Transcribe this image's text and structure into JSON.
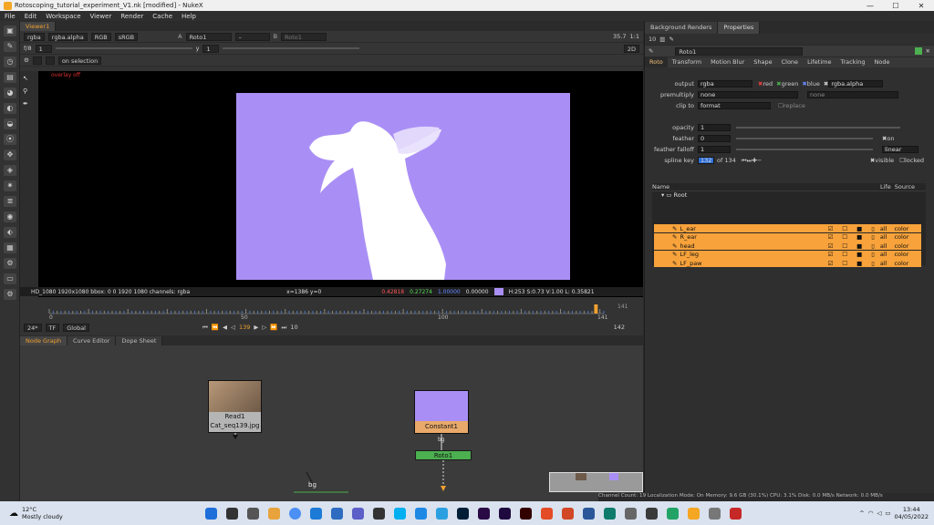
{
  "window": {
    "title": "Rotoscoping_tutorial_experiment_V1.nk [modified] - NukeX",
    "controls": [
      "—",
      "☐",
      "✕"
    ]
  },
  "menu": [
    "File",
    "Edit",
    "Workspace",
    "Viewer",
    "Render",
    "Cache",
    "Help"
  ],
  "viewer": {
    "tab": "Viewer1",
    "channels": "rgba",
    "alpha": "rgba.alpha",
    "colorspace_label": "RGB",
    "lut": "sRGB",
    "input_a_label": "A",
    "input_a": "Roto1",
    "input_b_label": "B",
    "input_b": "Roto1",
    "fstop": "f/8",
    "frame_step": "1",
    "gain_label": "1",
    "gamma_label": "y",
    "gamma": "1",
    "zoom": "35.7",
    "proxy": "1:1",
    "mode_2d": "2D",
    "on_selection": "on selection",
    "overlay_status": "overlay off",
    "info_format": "HD_1080 1920x1080  bbox: 0 0 1920 1080 channels: rgba",
    "info_coords": "x=1386 y=0",
    "info_r": "0.42818",
    "info_g": "0.27274",
    "info_b": "1.00000",
    "info_a": "0.00000",
    "info_hsv": "H:253 S:0.73 V:1.00  L: 0.35821"
  },
  "timeline": {
    "ticks": [
      "0",
      "50",
      "100",
      "141"
    ],
    "end_frame": "141",
    "fps": "24*",
    "tf": "TF",
    "scope": "Global",
    "current_frame": "139",
    "step": "10",
    "last_frame": "142"
  },
  "graph_tabs": [
    "Node Graph",
    "Curve Editor",
    "Dope Sheet"
  ],
  "nodes": {
    "read_name": "Read1",
    "read_file": "Cat_seq139.jpg",
    "constant_name": "Constant1",
    "roto_name": "Roto1",
    "bg_label": "bg",
    "constant_edge": "bg"
  },
  "right_panel": {
    "tabs": [
      "Background Renders",
      "Properties"
    ],
    "node_name": "Roto1",
    "count": "10",
    "prop_tabs": [
      "Roto",
      "Transform",
      "Motion Blur",
      "Shape",
      "Clone",
      "Lifetime",
      "Tracking",
      "Node"
    ],
    "output_label": "output",
    "output": "rgba",
    "out_red": "red",
    "out_green": "green",
    "out_blue": "blue",
    "out_alpha": "rgba.alpha",
    "premult_label": "premultiply",
    "premult": "none",
    "premult2": "none",
    "clipto_label": "clip to",
    "clipto": "format",
    "replace": "replace",
    "opacity_label": "opacity",
    "opacity": "1",
    "feather_label": "feather",
    "feather": "0",
    "falloff_label": "feather falloff",
    "falloff": "1",
    "falloff_mode": "linear",
    "on_label": "on",
    "spline_key_label": "spline key",
    "spline_key": "132",
    "spline_of": "of 134",
    "visible": "visible",
    "locked": "locked",
    "tree_headers": [
      "Name",
      "Life",
      "Source"
    ],
    "root": "Root",
    "layers": [
      {
        "name": "L_ear",
        "life": "all",
        "src": "color"
      },
      {
        "name": "R_ear",
        "life": "all",
        "src": "color"
      },
      {
        "name": "head",
        "life": "all",
        "src": "color"
      },
      {
        "name": "LF_leg",
        "life": "all",
        "src": "color"
      },
      {
        "name": "LF_paw",
        "life": "all",
        "src": "color"
      }
    ]
  },
  "status": "Channel Count: 19  Localization Mode: On  Memory: 9.6 GB (30.1%)  CPU: 3.1%  Disk: 0.0 MB/s  Network: 0.0 MB/s",
  "taskbar": {
    "weather_temp": "12°C",
    "weather_desc": "Mostly cloudy",
    "time": "13:44",
    "date": "04/05/2022"
  },
  "colors": {
    "matte_purple": "#a98ff5",
    "layer_orange": "#f7a23b",
    "roto_green": "#4caf50",
    "accent_orange": "#f0a030"
  }
}
